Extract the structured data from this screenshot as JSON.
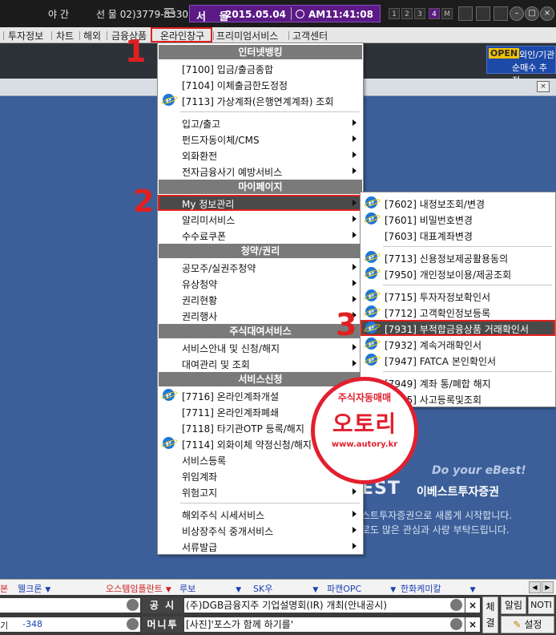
{
  "topbar": {
    "night_label": "야 간",
    "phone": "선 물 02)3779-8330",
    "city": "서 울",
    "date": "2015.05.04",
    "time": "AM11:41:08",
    "pages": [
      "1",
      "2",
      "3",
      "4",
      "M"
    ],
    "active_page": "4",
    "accent_color": "#5b1a86"
  },
  "menubar": {
    "items": [
      "투자정보",
      "차트",
      "해외",
      "금융상품",
      "온라인창구",
      "프리미엄서비스",
      "고객센터"
    ]
  },
  "openbadge": {
    "open": "OPEN",
    "line1": "외인/기관",
    "line2": "순매수 추정"
  },
  "steps": [
    "1",
    "2",
    "3"
  ],
  "menu1": {
    "headers": [
      "인터넷뱅킹",
      "마이페이지",
      "청약/권리",
      "주식대여서비스",
      "서비스신청"
    ],
    "banking": [
      "[7100] 입금/출금종합",
      "[7104] 이체출금한도정정",
      "[7113] 가상계좌(은행연계계좌) 조회"
    ],
    "banking_sub": [
      "입고/출고",
      "펀드자동이체/CMS",
      "외화환전",
      "전자금융사기 예방서비스"
    ],
    "mypage": [
      "My 정보관리",
      "알리미서비스",
      "수수료쿠폰"
    ],
    "rights": [
      "공모주/실권주청약",
      "유상청약",
      "권리현황",
      "권리행사"
    ],
    "lending": [
      "서비스안내 및 신청/해지",
      "대여관리 및 조회"
    ],
    "service": [
      "[7716] 온라인계좌개설",
      "[7711] 온라인계좌폐쇄",
      "[7118] 타기관OTP 등록/해지",
      "[7114] 외화이체 약정신청/해지",
      "서비스등록",
      "위임계좌",
      "위험고지"
    ],
    "extra": [
      "해외주식 시세서비스",
      "비상장주식 중개서비스",
      "서류발급"
    ]
  },
  "menu2": {
    "items": [
      "[7602] 내정보조회/변경",
      "[7601] 비밀번호변경",
      "[7603] 대표계좌변경",
      "[7713] 신용정보제공활용동의",
      "[7950] 개인정보이용/제공조회",
      "[7715] 투자자정보확인서",
      "[7712] 고객확인정보등록",
      "[7931] 부적합금융상품 거래확인서",
      "[7932] 계속거래확인서",
      "[7947] FATCA 본인확인서",
      "[7949] 계좌 통/폐합 해지",
      "[7905] 사고등록및조회"
    ]
  },
  "stamp": {
    "line1": "주식자동매매",
    "line2": "오토리",
    "line3": "www.autory.kr"
  },
  "ebest": {
    "slogan": "Do your eBest!",
    "logo": "EST",
    "name": "이베스트투자증권",
    "msg1": "스트투자증권으로 새롭게 시작합니다.",
    "msg2": "로도 많은 관심과 사랑 부탁드립니다."
  },
  "ticker": [
    "본",
    "웰크론",
    "오스템임플란트",
    "루보",
    "SK우",
    "파캔OPC",
    "한화케미칼"
  ],
  "bottom": {
    "left_label": "기",
    "left_value": "-348",
    "notice_tag": "공 시",
    "notice_text": "(주)DGB금융지주 기업설명회(IR) 개최(안내공시)",
    "money_tag": "머니투",
    "money_text": "[사진]'포스가 함께 하기를'",
    "x": "×",
    "settle_label": "체결",
    "alarm_label": "알림",
    "noti_label": "NOTI",
    "settings_label": "설정"
  }
}
